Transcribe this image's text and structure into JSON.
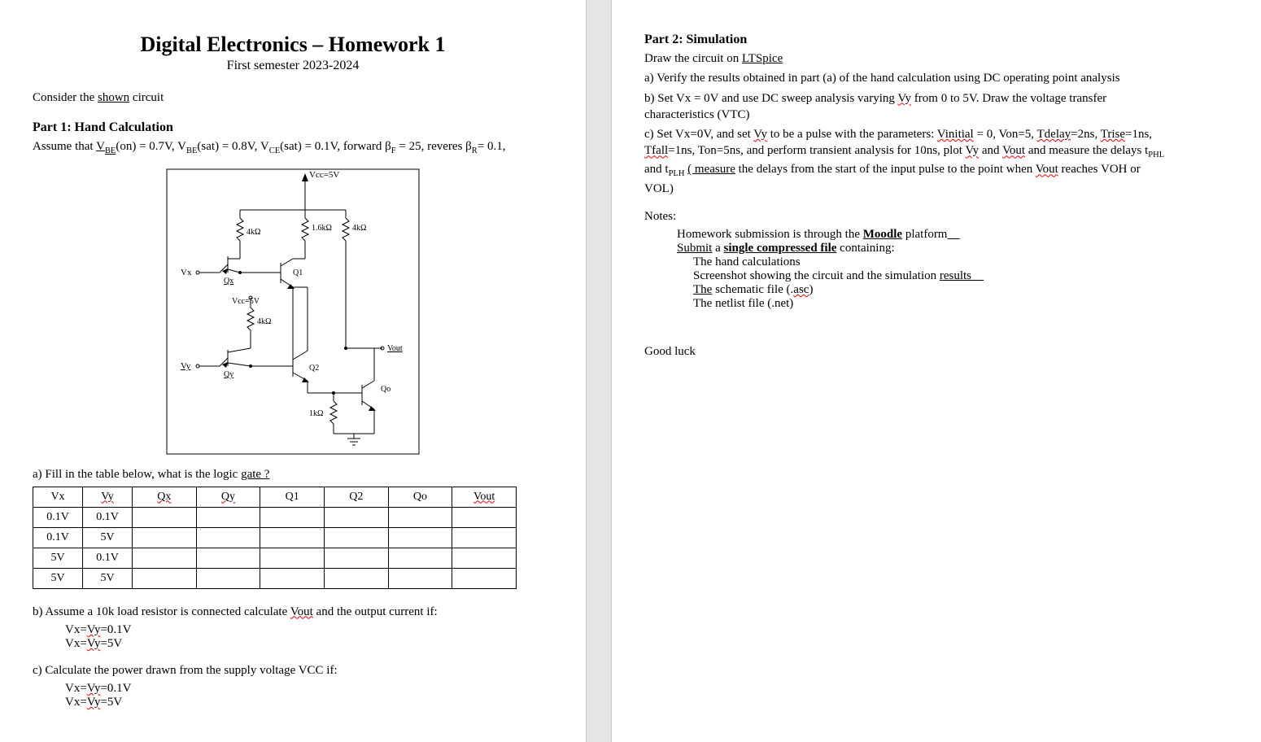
{
  "page1": {
    "title": "Digital Electronics – Homework 1",
    "subtitle": "First semester 2023-2024",
    "intro_pre": "Consider the ",
    "intro_shown": "shown",
    "intro_post": " circuit",
    "part1_title": "Part 1: Hand Calculation",
    "assume_pre": "Assume that ",
    "assume_vbeon_label": "V",
    "assume_vbeon_sub": "BE",
    "assume_vbeon_rest": "(on) = 0.7V, V",
    "assume_vbesat_sub": "BE",
    "assume_vbesat_rest": "(sat) = 0.8V, V",
    "assume_vcesat_sub": "CE",
    "assume_vcesat_rest": "(sat) = 0.1V, forward β",
    "assume_betaf_sub": "F",
    "assume_betaf_rest": " = 25, reveres β",
    "assume_betar_sub": "R",
    "assume_betar_rest": "= 0.1,",
    "diagram": {
      "vcc_top": "Vcc=5V",
      "r_4k": "4kΩ",
      "r_1p6k": "1.6kΩ",
      "r_4k_b": "4kΩ",
      "vcc_mid": "Vcc=5V",
      "r_4k_c": "4kΩ",
      "r_1k": "1kΩ",
      "vx": "Vx",
      "vy": "Vy",
      "qx": "Qx",
      "qy": "Qy",
      "q1": "Q1",
      "q2": "Q2",
      "qo": "Qo",
      "vout": "Vout"
    },
    "a_lead_pre": "a) Fill in the table below, what is the logic ",
    "a_lead_gate": "gate ?",
    "table": {
      "headers": [
        "Vx",
        "Vy",
        "Qx",
        "Qy",
        "Q1",
        "Q2",
        "Qo",
        "Vout"
      ],
      "rows": [
        [
          "0.1V",
          "0.1V",
          "",
          "",
          "",
          "",
          "",
          ""
        ],
        [
          "0.1V",
          "5V",
          "",
          "",
          "",
          "",
          "",
          ""
        ],
        [
          "5V",
          "0.1V",
          "",
          "",
          "",
          "",
          "",
          ""
        ],
        [
          "5V",
          "5V",
          "",
          "",
          "",
          "",
          "",
          ""
        ]
      ]
    },
    "b_lead_pre": "b) Assume a 10k load resistor is connected calculate ",
    "b_lead_vout": "Vout",
    "b_lead_post": " and the output current if:",
    "b_line1_pre": "Vx=",
    "b_line1_vy": "Vy",
    "b_line1_post": "=0.1V",
    "b_line2_pre": "Vx=",
    "b_line2_vy": "Vy",
    "b_line2_post": "=5V",
    "c_lead": "c) Calculate the power drawn from the supply voltage VCC if:",
    "c_line1_pre": "Vx=",
    "c_line1_vy": "Vy",
    "c_line1_post": "=0.1V",
    "c_line2_pre": "Vx=",
    "c_line2_vy": "Vy",
    "c_line2_post": "=5V"
  },
  "page2": {
    "part2_title": "Part 2: Simulation",
    "line1_pre": "Draw the circuit on ",
    "line1_ltspice": "LTSpice",
    "line_a": "a) Verify the results obtained in part (a) of the hand calculation using DC operating point analysis",
    "line_b_pre": "b) Set Vx = 0V and use DC sweep analysis varying ",
    "line_b_vy": "Vy",
    "line_b_post": " from 0 to 5V. Draw the voltage transfer characteristics (VTC)",
    "line_c_pre": "c) Set Vx=0V, and set ",
    "line_c_vy1": "Vy",
    "line_c_mid1": " to be a pulse with the parameters: ",
    "line_c_vinitial": "Vinitial",
    "line_c_mid2": " = 0, Von=5, ",
    "line_c_tdelay": "Tdelay",
    "line_c_mid3": "=2ns, ",
    "line_c_trise": "Trise",
    "line_c_mid4": "=1ns, ",
    "line_c_tfall": "Tfall",
    "line_c_mid5": "=1ns, Ton=5ns, and perform transient analysis for 10ns, plot ",
    "line_c_vy2": "Vy",
    "line_c_and": " and ",
    "line_c_vout1": "Vout",
    "line_c_mid6": " and measure the delays t",
    "line_c_phl": "PHL",
    "line_c_mid7": " and t",
    "line_c_plh": "PLH",
    "line_c_mid8": " ",
    "line_c_measure": "( measure",
    "line_c_mid9": " the delays from the start of the input pulse to the point when ",
    "line_c_vout2": "Vout",
    "line_c_end": " reaches VOH or VOL)",
    "notes_label": "Notes:",
    "note1_pre": "Homework submission is through the ",
    "note1_moodle": "Moodle",
    "note1_post": " platform",
    "note2_pre": "Submit",
    "note2_mid": " a ",
    "note2_single": "single compressed file",
    "note2_post": " containing:",
    "note_hand": "The hand calculations",
    "note_screenshot_pre": "Screenshot showing the circuit and the simulation ",
    "note_screenshot_results": "results",
    "note_asc_pre": "The",
    "note_asc_mid": " schematic file (.",
    "note_asc_word": "asc",
    "note_asc_post": ")",
    "note_net": "The netlist file (.net)",
    "goodluck": "Good luck"
  }
}
